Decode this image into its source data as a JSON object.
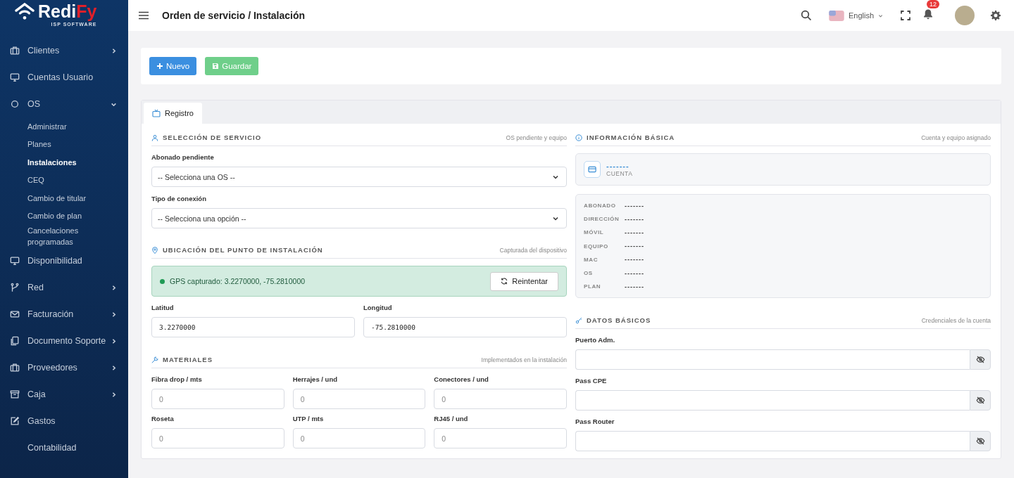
{
  "brand": {
    "name": "Redi",
    "name_accent": "Fy",
    "tagline": "ISP SOFTWARE"
  },
  "sidebar": {
    "items": [
      {
        "label": "Clientes",
        "has_submenu": true,
        "expanded": false,
        "selected": false
      },
      {
        "label": "Cuentas Usuario",
        "has_submenu": false,
        "selected": false
      },
      {
        "label": "OS",
        "has_submenu": true,
        "expanded": true,
        "selected": false,
        "children": [
          {
            "label": "Administrar",
            "selected": false
          },
          {
            "label": "Planes",
            "selected": false
          },
          {
            "label": "Instalaciones",
            "selected": true
          },
          {
            "label": "CEQ",
            "selected": false
          },
          {
            "label": "Cambio de titular",
            "selected": false
          },
          {
            "label": "Cambio de plan",
            "selected": false
          },
          {
            "label": "Cancelaciones programadas",
            "selected": false
          }
        ]
      },
      {
        "label": "Disponibilidad",
        "has_submenu": false,
        "selected": false
      },
      {
        "label": "Red",
        "has_submenu": true,
        "expanded": false,
        "selected": false
      },
      {
        "label": "Facturación",
        "has_submenu": true,
        "expanded": false,
        "selected": false
      },
      {
        "label": "Documento Soporte",
        "has_submenu": true,
        "expanded": false,
        "selected": false
      },
      {
        "label": "Proveedores",
        "has_submenu": true,
        "expanded": false,
        "selected": false
      },
      {
        "label": "Caja",
        "has_submenu": true,
        "expanded": false,
        "selected": false
      },
      {
        "label": "Gastos",
        "has_submenu": false,
        "selected": false
      },
      {
        "label": "Contabilidad",
        "has_submenu": false,
        "selected": false
      }
    ]
  },
  "header": {
    "title": "Orden de servicio / Instalación",
    "language": "English",
    "notification_count": "12"
  },
  "toolbar": {
    "buttons": [
      {
        "label": "Nuevo",
        "kind": "new"
      },
      {
        "label": "Guardar",
        "kind": "save"
      }
    ]
  },
  "tabs": [
    {
      "label": "Registro",
      "selected": true
    }
  ],
  "service_selection": {
    "title": "SELECCIÓN DE SERVICIO",
    "note": "OS pendiente y equipo",
    "fields": [
      {
        "label": "Abonado pendiente",
        "value": "-- Selecciona una OS --"
      },
      {
        "label": "Tipo de conexión",
        "value": "-- Selecciona una opción --"
      }
    ]
  },
  "location": {
    "title": "UBICACIÓN DEL PUNTO DE INSTALACIÓN",
    "note": "Capturada del dispositivo",
    "gps_status": "GPS capturado: 3.2270000, -75.2810000",
    "retry_button": "Reintentar",
    "fields": [
      {
        "label": "Latitud",
        "value": "3.2270000"
      },
      {
        "label": "Longitud",
        "value": "-75.2810000"
      }
    ]
  },
  "materials": {
    "title": "MATERIALES",
    "note": "Implementados en la instalación",
    "fields": [
      {
        "label": "Fibra drop / mts",
        "placeholder": "0"
      },
      {
        "label": "Herrajes / und",
        "placeholder": "0"
      },
      {
        "label": "Conectores / und",
        "placeholder": "0"
      },
      {
        "label": "Roseta",
        "placeholder": "0"
      },
      {
        "label": "UTP / mts",
        "placeholder": "0"
      },
      {
        "label": "RJ45 / und",
        "placeholder": "0"
      }
    ]
  },
  "basic_info": {
    "title": "INFORMACIÓN BÁSICA",
    "note": "Cuenta y equipo asignado",
    "account_value": "-------",
    "account_label": "CUENTA",
    "rows": [
      {
        "label": "ABONADO",
        "value": "-------"
      },
      {
        "label": "DIRECCIÓN",
        "value": "-------"
      },
      {
        "label": "MÓVIL",
        "value": "-------"
      },
      {
        "label": "EQUIPO",
        "value": "-------"
      },
      {
        "label": "MAC",
        "value": "-------"
      },
      {
        "label": "OS",
        "value": "-------"
      },
      {
        "label": "PLAN",
        "value": "-------"
      }
    ]
  },
  "basic_data": {
    "title": "DATOS BÁSICOS",
    "note": "Credenciales de la cuenta",
    "fields": [
      {
        "label": "Puerto Adm."
      },
      {
        "label": "Pass CPE"
      },
      {
        "label": "Pass Router"
      }
    ]
  }
}
